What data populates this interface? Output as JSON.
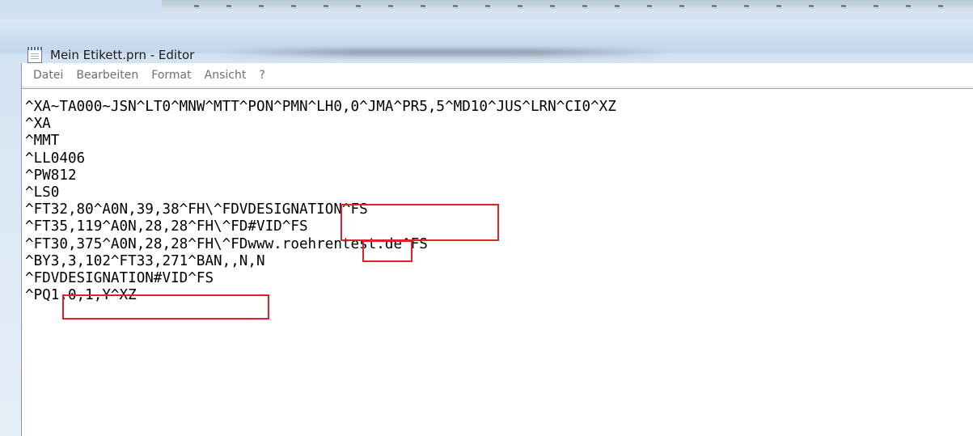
{
  "window": {
    "title": "Mein Etikett.prn - Editor"
  },
  "menu": {
    "items": [
      {
        "label": "Datei"
      },
      {
        "label": "Bearbeiten"
      },
      {
        "label": "Format"
      },
      {
        "label": "Ansicht"
      },
      {
        "label": "?"
      }
    ]
  },
  "document": {
    "lines": [
      "^XA~TA000~JSN^LT0^MNW^MTT^PON^PMN^LH0,0^JMA^PR5,5^MD10^JUS^LRN^CI0^XZ",
      "^XA",
      "^MMT",
      "^LL0406",
      "^PW812",
      "^LS0",
      "^FT32,80^A0N,39,38^FH\\^FDVDESIGNATION^FS",
      "^FT35,119^A0N,28,28^FH\\^FD#VID^FS",
      "^FT30,375^A0N,28,28^FH\\^FDwww.roehrentest.de^FS",
      "^BY3,3,102^FT33,271^BAN,,N,N",
      "^FDVDESIGNATION#VID^FS",
      "^PQ1,0,1,Y^XZ"
    ]
  },
  "highlights": [
    {
      "label": "VDESIGNATION"
    },
    {
      "label": "VID"
    },
    {
      "label": "VDESIGNATION#VID"
    }
  ],
  "colors": {
    "highlight_border": "#e0202a",
    "menu_text": "#6f6f6f",
    "title_bar": "#cddff0"
  }
}
